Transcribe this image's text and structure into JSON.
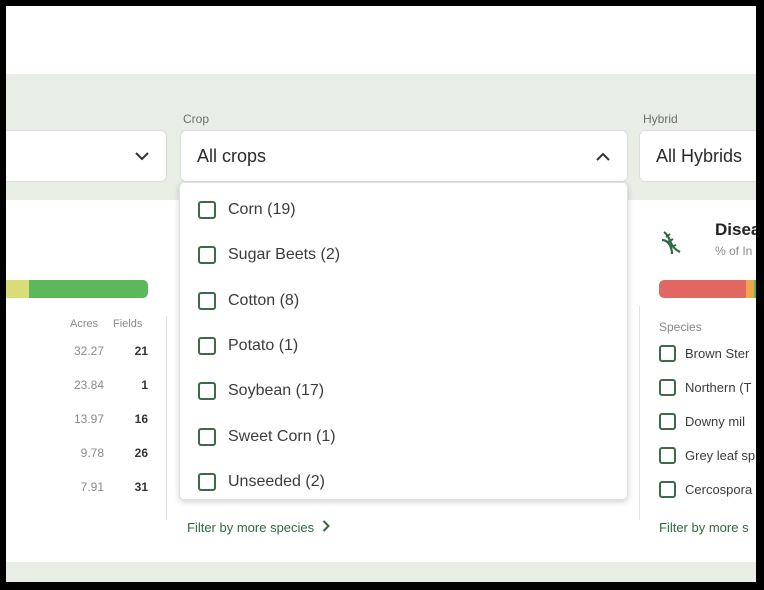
{
  "filters": {
    "crop": {
      "label": "Crop",
      "value": "All crops"
    },
    "hybrid": {
      "label": "Hybrid",
      "value": "All Hybrids"
    }
  },
  "crop_dropdown": {
    "options": [
      {
        "label": "Corn (19)"
      },
      {
        "label": "Sugar Beets (2)"
      },
      {
        "label": "Cotton (8)"
      },
      {
        "label": "Potato (1)"
      },
      {
        "label": "Soybean (17)"
      },
      {
        "label": "Sweet Corn (1)"
      },
      {
        "label": "Unseeded (2)"
      }
    ]
  },
  "left_card": {
    "columns": {
      "acres": "Acres",
      "fields": "Fields"
    },
    "rows": [
      {
        "acres": "32.27",
        "fields": "21"
      },
      {
        "acres": "23.84",
        "fields": "1"
      },
      {
        "acres": "13.97",
        "fields": "16"
      },
      {
        "acres": "9.78",
        "fields": "26"
      },
      {
        "acres": "7.91",
        "fields": "31"
      }
    ],
    "filter_link": "Filter by more species"
  },
  "right_card": {
    "title": "Disea",
    "subtitle": "% of In",
    "species_header": "Species",
    "species": [
      {
        "label": "Brown Ster"
      },
      {
        "label": "Northern (T"
      },
      {
        "label": "Downy mil"
      },
      {
        "label": "Grey leaf sp"
      },
      {
        "label": "Cercospora"
      }
    ],
    "filter_link": "Filter by more s"
  },
  "colors": {
    "band": "#e8eee5",
    "accent_green": "#2f6b3f",
    "bar_green": "#5db85c",
    "bar_yellow": "#d9dd78",
    "bar_red": "#e06762",
    "bar_orange": "#f0a64a"
  },
  "icons": {
    "select_closed": "chevron-down-icon",
    "select_open": "chevron-up-icon",
    "link": "chevron-right-icon",
    "disease": "dna-icon"
  }
}
